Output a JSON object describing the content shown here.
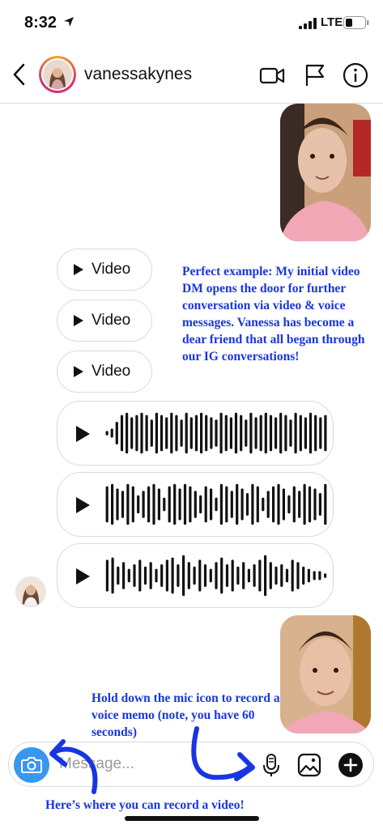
{
  "status": {
    "time": "8:32",
    "network": "LTE",
    "icons": [
      "location-arrow-icon",
      "signal-bars-icon",
      "battery-icon"
    ]
  },
  "header": {
    "username": "vanessakynes",
    "icons": [
      "back-chevron-icon",
      "video-call-icon",
      "flag-icon",
      "info-icon"
    ]
  },
  "messages": {
    "video_pills": [
      {
        "label": "Video"
      },
      {
        "label": "Video"
      },
      {
        "label": "Video"
      }
    ],
    "voice_messages_count": 3
  },
  "annotations": {
    "main_note": "Perfect example: My initial video DM opens the door for further conversation via video & voice messages. Vanessa has become a dear friend that all began through our IG conversations!",
    "mic_note": "Hold down the mic icon to record a voice memo (note, you have 60 seconds)",
    "camera_note": "Here’s where you can record a video!"
  },
  "composer": {
    "placeholder": "Message...",
    "icons": [
      "camera-icon",
      "microphone-icon",
      "gallery-icon",
      "plus-icon"
    ]
  },
  "colors": {
    "accent_blue": "#3897f0",
    "annotation_blue": "#1836e0",
    "avatar_ring": "#e1306c"
  }
}
